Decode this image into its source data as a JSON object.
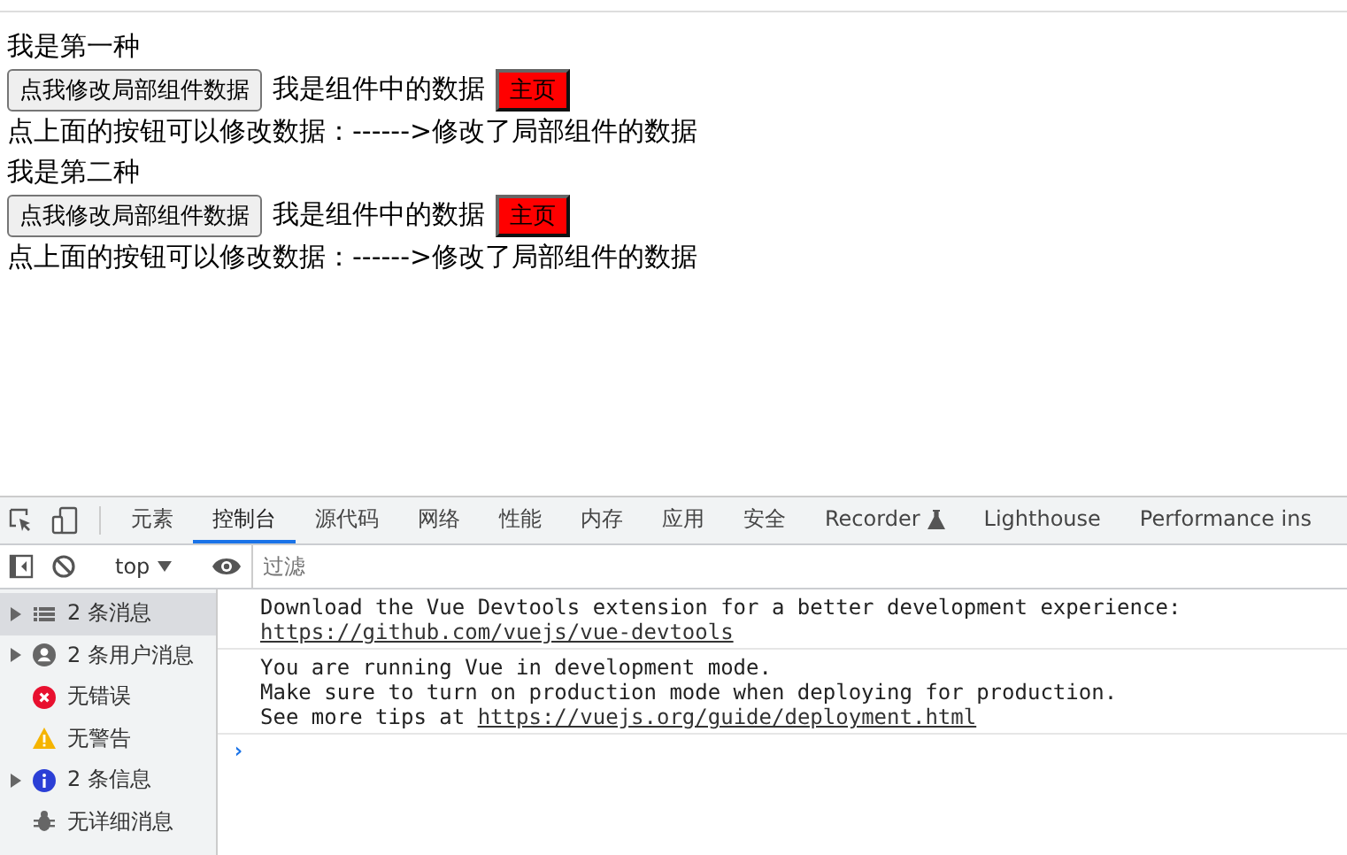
{
  "page": {
    "sections": [
      {
        "title": "我是第一种",
        "button": "点我修改局部组件数据",
        "data_text": "我是组件中的数据",
        "home_button": "主页",
        "hint": "点上面的按钮可以修改数据：------>修改了局部组件的数据"
      },
      {
        "title": "我是第二种",
        "button": "点我修改局部组件数据",
        "data_text": "我是组件中的数据",
        "home_button": "主页",
        "hint": "点上面的按钮可以修改数据：------>修改了局部组件的数据"
      }
    ]
  },
  "devtools": {
    "tabs": [
      {
        "label": "元素",
        "selected": false
      },
      {
        "label": "控制台",
        "selected": true
      },
      {
        "label": "源代码",
        "selected": false
      },
      {
        "label": "网络",
        "selected": false
      },
      {
        "label": "性能",
        "selected": false
      },
      {
        "label": "内存",
        "selected": false
      },
      {
        "label": "应用",
        "selected": false
      },
      {
        "label": "安全",
        "selected": false
      },
      {
        "label": "Recorder",
        "selected": false,
        "flask": true
      },
      {
        "label": "Lighthouse",
        "selected": false
      },
      {
        "label": "Performance ins",
        "selected": false
      }
    ],
    "toolbar": {
      "context": "top",
      "filter_placeholder": "过滤"
    },
    "sidebar": {
      "items": [
        {
          "kind": "list",
          "label": "2 条消息",
          "expandable": true,
          "selected": true
        },
        {
          "kind": "user",
          "label": "2 条用户消息",
          "expandable": true,
          "selected": false
        },
        {
          "kind": "error",
          "label": "无错误",
          "expandable": false,
          "selected": false
        },
        {
          "kind": "warning",
          "label": "无警告",
          "expandable": false,
          "selected": false
        },
        {
          "kind": "info",
          "label": "2 条信息",
          "expandable": true,
          "selected": false
        },
        {
          "kind": "verbose",
          "label": "无详细消息",
          "expandable": false,
          "selected": false
        }
      ]
    },
    "messages": [
      {
        "lines": [
          {
            "text": "Download the Vue Devtools extension for a better development experience:"
          },
          {
            "link": "https://github.com/vuejs/vue-devtools"
          }
        ]
      },
      {
        "lines": [
          {
            "text": "You are running Vue in development mode."
          },
          {
            "text": "Make sure to turn on production mode when deploying for production."
          },
          {
            "text": "See more tips at ",
            "link": "https://vuejs.org/guide/deployment.html"
          }
        ]
      }
    ],
    "prompt": "›"
  }
}
